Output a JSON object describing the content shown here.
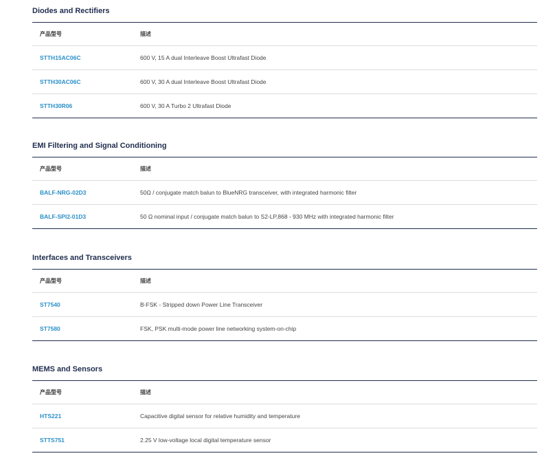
{
  "sections": [
    {
      "title": "Diodes and Rectifiers",
      "header": {
        "part": "产品型号",
        "desc": "描述"
      },
      "rows": [
        {
          "part": "STTH15AC06C",
          "desc": "600 V, 15 A dual Interleave Boost Ultrafast Diode"
        },
        {
          "part": "STTH30AC06C",
          "desc": "600 V, 30 A dual Interleave Boost Ultrafast Diode"
        },
        {
          "part": "STTH30R06",
          "desc": "600 V, 30 A Turbo 2 Ultrafast Diode"
        }
      ]
    },
    {
      "title": "EMI Filtering and Signal Conditioning",
      "header": {
        "part": "产品型号",
        "desc": "描述"
      },
      "rows": [
        {
          "part": "BALF-NRG-02D3",
          "desc": "50Ω / conjugate match balun to BlueNRG transceiver, with integrated harmonic filter"
        },
        {
          "part": "BALF-SPI2-01D3",
          "desc": "50 Ω nominal input / conjugate match balun to S2-LP,868 - 930 MHz with integrated harmonic filter"
        }
      ]
    },
    {
      "title": "Interfaces and Transceivers",
      "header": {
        "part": "产品型号",
        "desc": "描述"
      },
      "rows": [
        {
          "part": "ST7540",
          "desc": "B-FSK - Stripped down Power Line Transceiver"
        },
        {
          "part": "ST7580",
          "desc": "FSK, PSK multi-mode power line networking system-on-chip"
        }
      ]
    },
    {
      "title": "MEMS and Sensors",
      "header": {
        "part": "产品型号",
        "desc": "描述"
      },
      "rows": [
        {
          "part": "HTS221",
          "desc": "Capacitive digital sensor for relative humidity and temperature"
        },
        {
          "part": "STTS751",
          "desc": "2.25 V low-voltage local digital temperature sensor"
        }
      ]
    }
  ],
  "colors": {
    "link": "#2a8fc7",
    "title": "#1f2d4d",
    "divider": "#dcdcdc"
  }
}
